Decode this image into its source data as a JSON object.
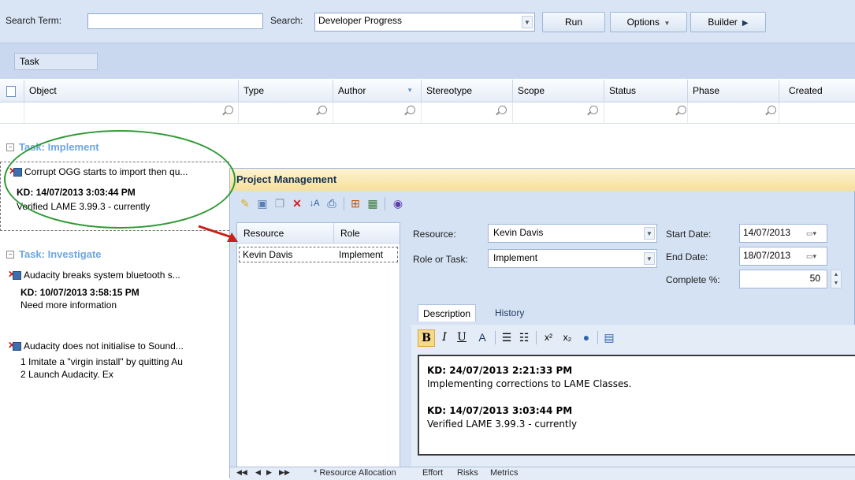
{
  "search": {
    "term_label": "Search Term:",
    "term_value": "",
    "search_label": "Search:",
    "search_value": "Developer Progress",
    "run_label": "Run",
    "options_label": "Options",
    "builder_label": "Builder"
  },
  "grouping": {
    "chip": "Task"
  },
  "columns": [
    "Object",
    "Type",
    "Author",
    "Stereotype",
    "Scope",
    "Status",
    "Phase",
    "Created"
  ],
  "groups": [
    {
      "title": "Task: Implement",
      "items": [
        {
          "name": "Corrupt OGG starts to import then qu...",
          "line1": "KD: 14/07/2013 3:03:44 PM",
          "line2": "Verified LAME 3.99.3 - currently"
        }
      ]
    },
    {
      "title": "Task: Investigate",
      "items": [
        {
          "name": "Audacity breaks system bluetooth s...",
          "line1": "KD: 10/07/2013 3:58:15 PM",
          "line2": "Need more information"
        },
        {
          "name": "Audacity does not initialise to Sound...",
          "line1": "1 Imitate a \"virgin install\" by quitting Au",
          "line2": "2 Launch Audacity. Ex"
        }
      ]
    }
  ],
  "pm": {
    "title": "Project Management",
    "table": {
      "headers": [
        "Resource",
        "Role"
      ],
      "rows": [
        {
          "resource": "Kevin Davis",
          "role": "Implement"
        }
      ]
    },
    "form": {
      "resource_label": "Resource:",
      "resource_value": "Kevin Davis",
      "role_label": "Role or Task:",
      "role_value": "Implement",
      "start_label": "Start Date:",
      "start_value": "14/07/2013",
      "end_label": "End Date:",
      "end_value": "18/07/2013",
      "complete_label": "Complete %:",
      "complete_value": "50"
    },
    "tabs": [
      "Description",
      "History"
    ],
    "editor": {
      "entry1_head": "KD: 24/07/2013 2:21:33 PM",
      "entry1_text": "Implementing corrections to LAME Classes.",
      "entry2_head": "KD: 14/07/2013 3:03:44 PM",
      "entry2_text": "Verified LAME 3.99.3 - currently"
    },
    "bottom_tabs": [
      "* Resource Allocation",
      "Effort",
      "Risks",
      "Metrics"
    ]
  },
  "colors": {
    "annotation_oval": "#2f9a35",
    "annotation_arrow": "#c8201a",
    "group_title": "#6ea6e0"
  }
}
